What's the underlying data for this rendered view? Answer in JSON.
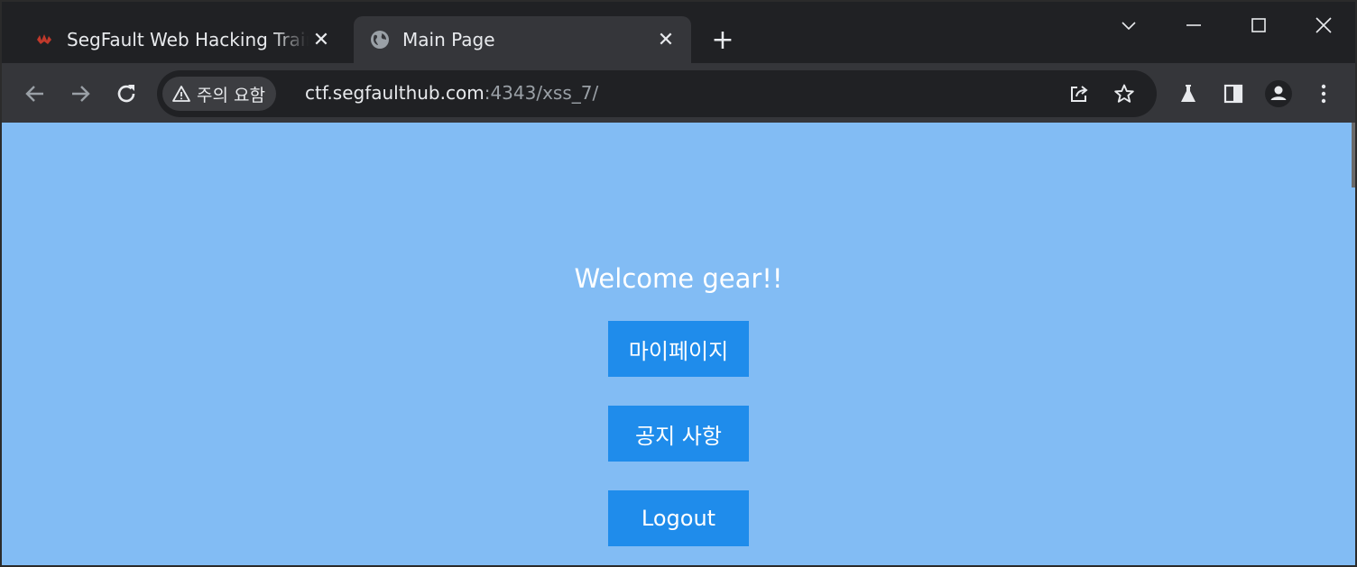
{
  "browser": {
    "tabs": [
      {
        "title": "SegFault Web Hacking Training",
        "icon": "segfault-favicon",
        "active": false,
        "close": "✕"
      },
      {
        "title": "Main Page",
        "icon": "globe-icon",
        "active": true,
        "close": "✕"
      }
    ],
    "new_tab": "+",
    "security_label": "주의 요함",
    "url_host": "ctf.segfaulthub.com",
    "url_rest": ":4343/xss_7/"
  },
  "page": {
    "welcome": "Welcome gear!!",
    "buttons": {
      "mypage": "마이페이지",
      "notice": "공지 사항",
      "logout": "Logout"
    },
    "colors": {
      "background": "#82bcf4",
      "button": "#1f8ceb"
    }
  }
}
